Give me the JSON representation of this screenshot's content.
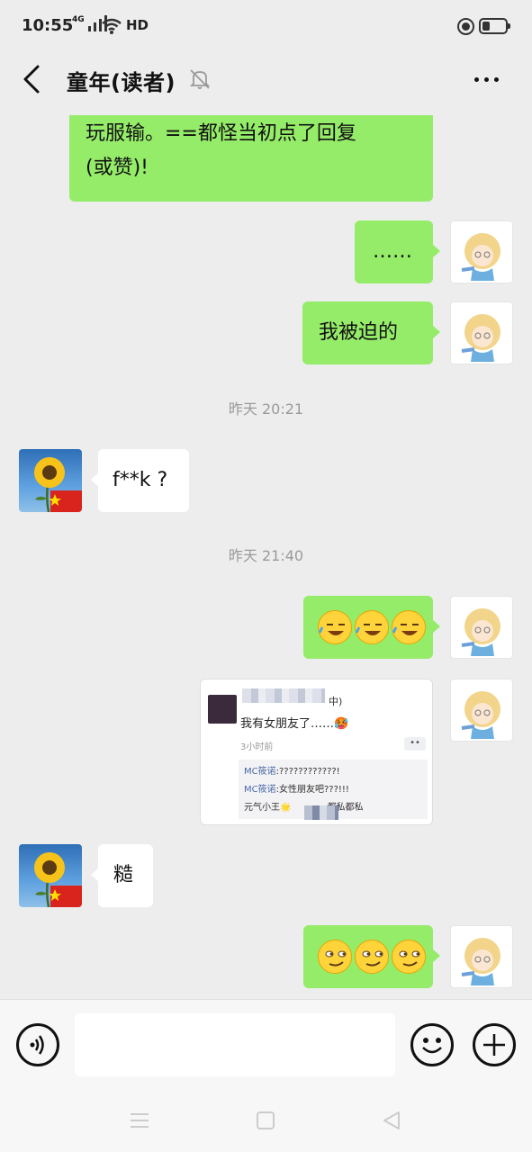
{
  "status_bar": {
    "time": "10:55",
    "network": "4G",
    "hd": "HD"
  },
  "header": {
    "title": "童年(读者)"
  },
  "messages": [
    {
      "text": "玩服输。==都怪当初点了回复\n(或赞)!"
    },
    {
      "text": "……"
    },
    {
      "text": "我被迫的"
    },
    {
      "time": "昨天 20:21"
    },
    {
      "text": "f**k ?"
    },
    {
      "time": "昨天 21:40"
    },
    {
      "emojis": [
        "face-with-tears",
        "face-with-tears",
        "face-with-tears"
      ]
    },
    {
      "card": {
        "user_suffix": "中)",
        "text": "我有女朋友了……🥵",
        "time": "3小时前",
        "dots": "••",
        "comments": [
          {
            "name": "MC筱诺",
            "content": ":????????????!"
          },
          {
            "name": "MC筱诺",
            "content": ":女性朋友吧???!!!"
          },
          {
            "name": "元气小王🌟",
            "content": "都私都私"
          }
        ]
      }
    },
    {
      "text": "糙"
    },
    {
      "emojis": [
        "smirk-face",
        "smirk-face",
        "smirk-face"
      ]
    }
  ],
  "colors": {
    "sent_bubble": "#95ec69",
    "received_bubble": "#ffffff",
    "background": "#ededed"
  }
}
